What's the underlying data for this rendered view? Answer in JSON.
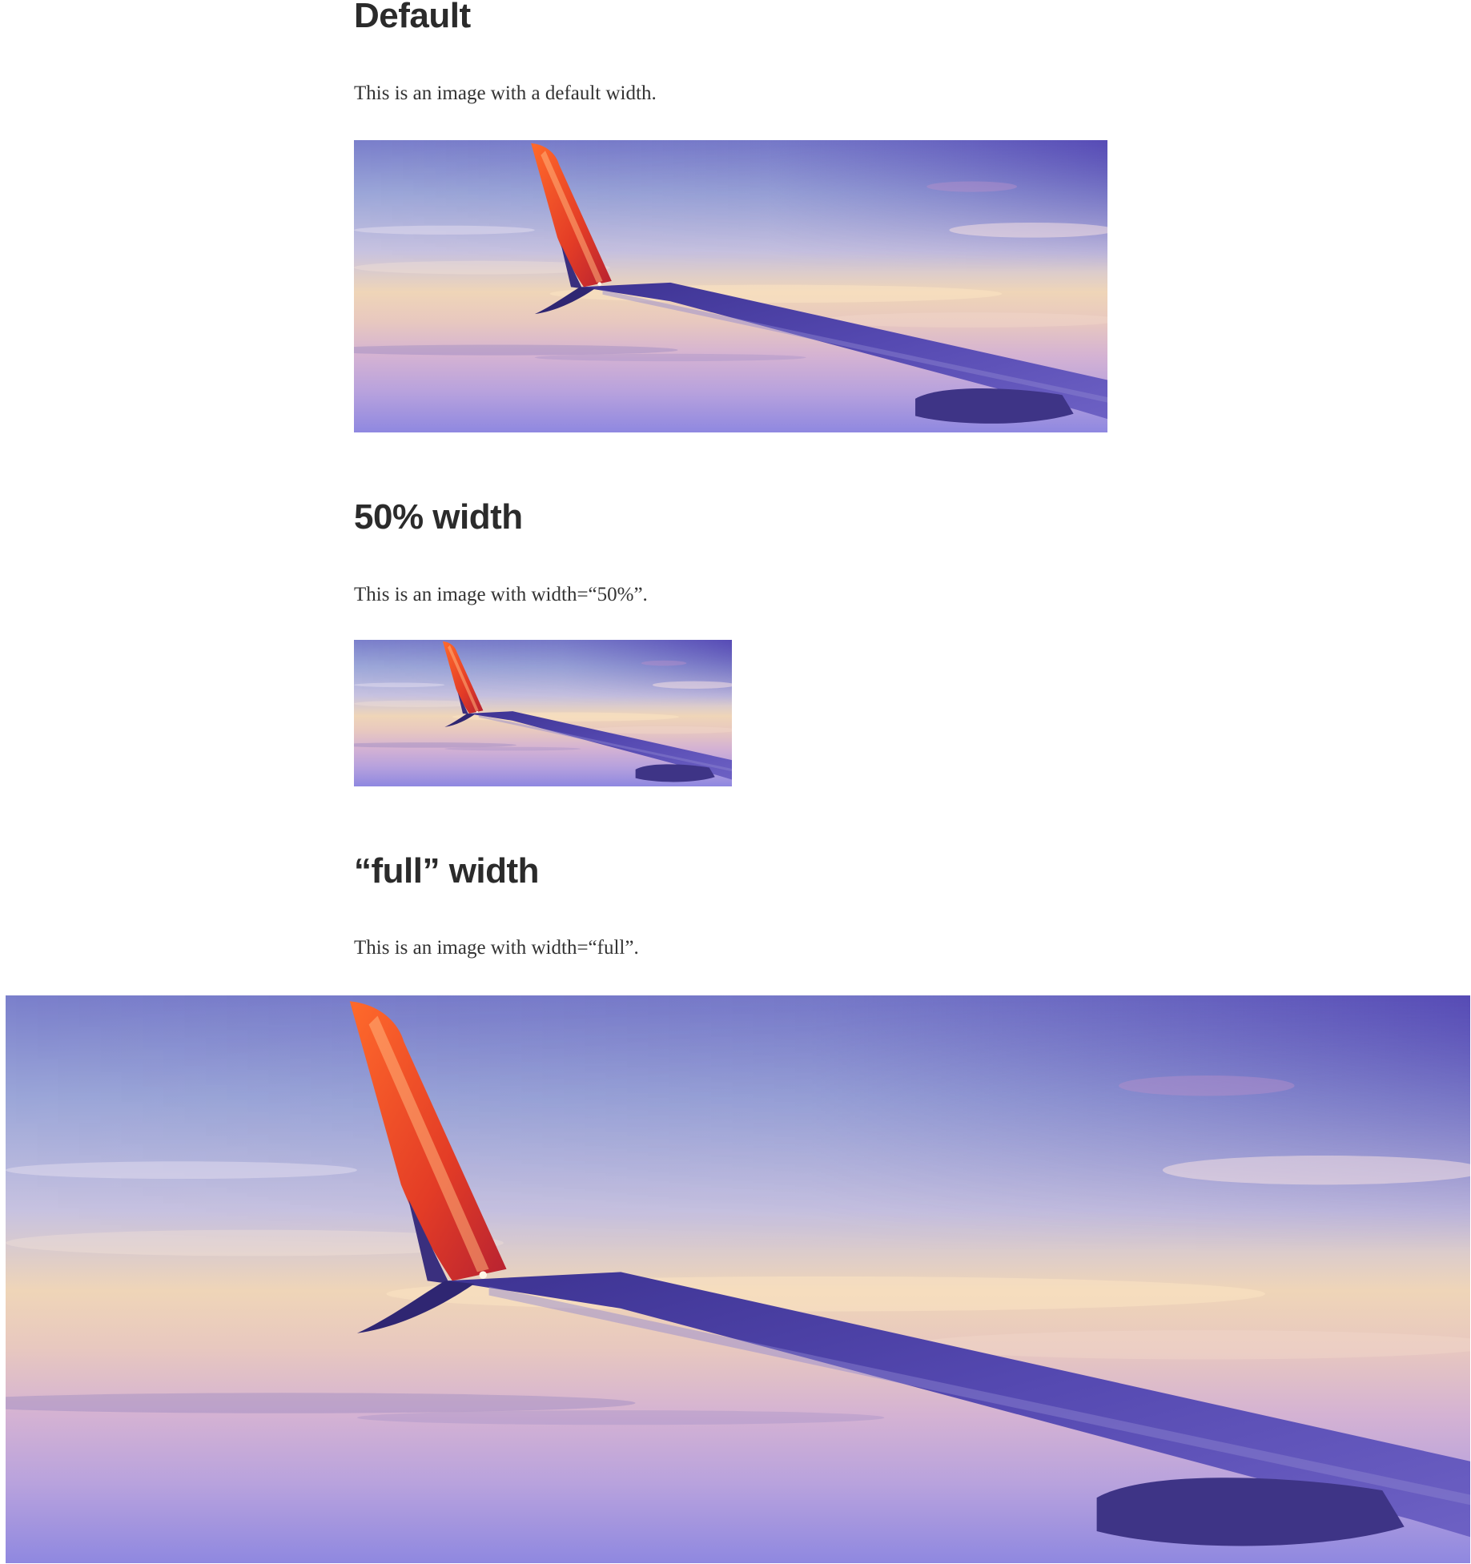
{
  "sections": {
    "default": {
      "heading": "Default",
      "text": "This is an image with a default width."
    },
    "half": {
      "heading": "50% width",
      "text": "This is an image with width=“50%”."
    },
    "full": {
      "heading": "“full” width",
      "text": "This is an image with width=“full”."
    }
  },
  "image": {
    "subject": "airplane-wing-over-sunset-clouds",
    "colors": {
      "sky_top": "#5b4fb8",
      "sky_mid": "#9aa6d6",
      "horizon": "#f0d3b3",
      "clouds_low": "#c8a3d0",
      "bottom": "#8f86dc",
      "wing": "#4b43a6",
      "winglet": "#e3482b",
      "winglet_dark": "#3a2f7e"
    }
  }
}
